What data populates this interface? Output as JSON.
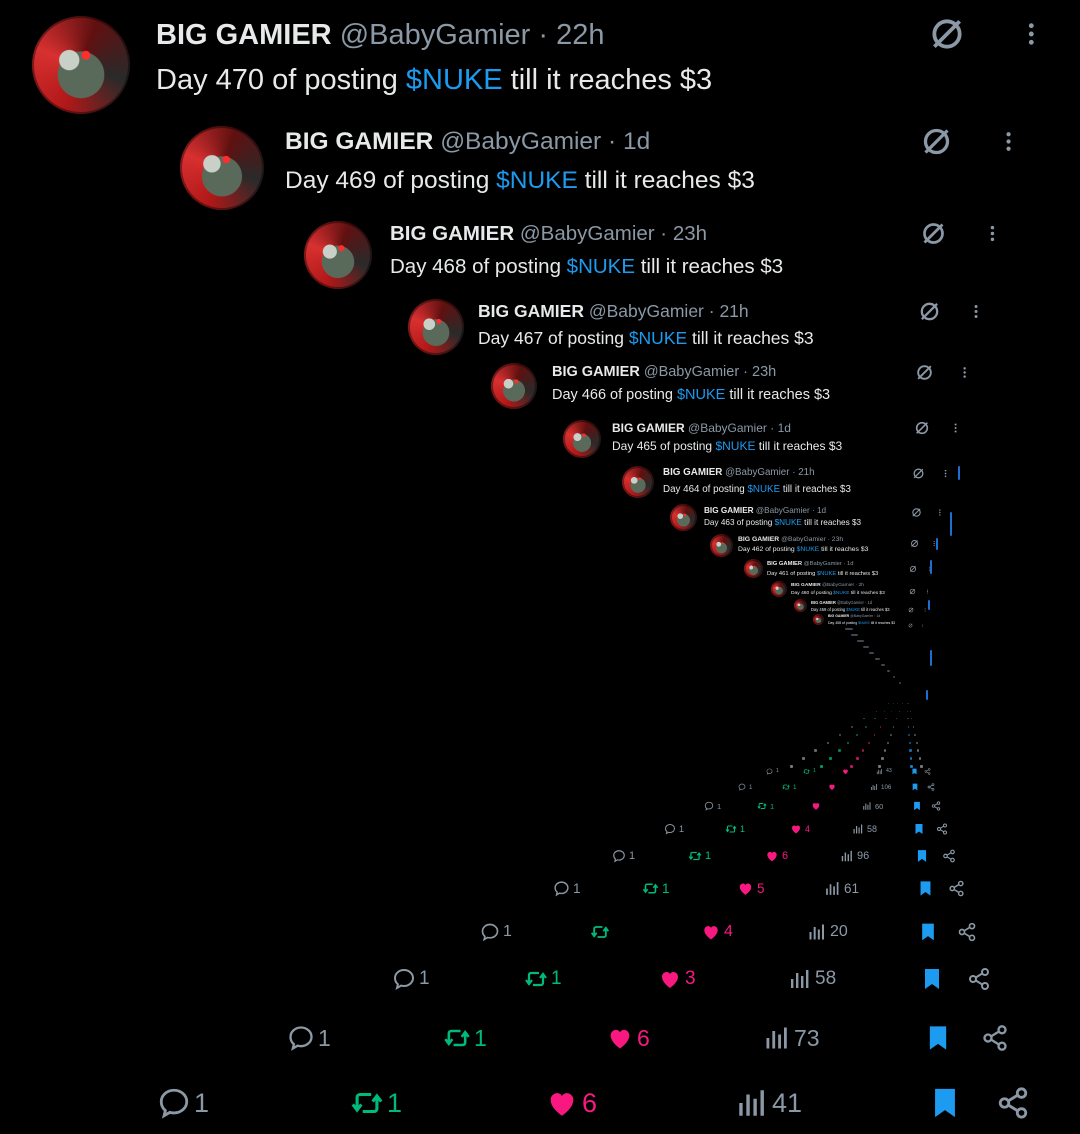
{
  "author": {
    "name": "BIG GAMIER",
    "handle": "@BabyGamier"
  },
  "body": {
    "prefix": "Day ",
    "middle": " of posting ",
    "ticker": "$NUKE",
    "suffix": " till it reaches $3"
  },
  "posts": [
    {
      "day": "470",
      "time": "22h"
    },
    {
      "day": "469",
      "time": "1d"
    },
    {
      "day": "468",
      "time": "23h"
    },
    {
      "day": "467",
      "time": "21h"
    },
    {
      "day": "466",
      "time": "23h"
    },
    {
      "day": "465",
      "time": "1d"
    },
    {
      "day": "464",
      "time": "21h"
    },
    {
      "day": "463",
      "time": "1d"
    },
    {
      "day": "462",
      "time": "23h"
    },
    {
      "day": "461",
      "time": "1d"
    },
    {
      "day": "460",
      "time": "2h"
    },
    {
      "day": "459",
      "time": "1d"
    },
    {
      "day": "458",
      "time": "1d"
    }
  ],
  "action_rows": [
    {
      "replies": "1",
      "reposts": "1",
      "likes": "6",
      "views": "41"
    },
    {
      "replies": "1",
      "reposts": "1",
      "likes": "6",
      "views": "73"
    },
    {
      "replies": "1",
      "reposts": "1",
      "likes": "3",
      "views": "58"
    },
    {
      "replies": "1",
      "reposts": "",
      "likes": "4",
      "views": "20"
    },
    {
      "replies": "1",
      "reposts": "1",
      "likes": "5",
      "views": "61"
    },
    {
      "replies": "1",
      "reposts": "1",
      "likes": "6",
      "views": "96"
    },
    {
      "replies": "1",
      "reposts": "1",
      "likes": "4",
      "views": "58"
    },
    {
      "replies": "1",
      "reposts": "1",
      "likes": "",
      "views": "60"
    },
    {
      "replies": "1",
      "reposts": "1",
      "likes": "",
      "views": "106"
    },
    {
      "replies": "1",
      "reposts": "1",
      "likes": "",
      "views": "43"
    }
  ],
  "icons": {
    "grok": "slashed-circle-icon",
    "more": "more-vertical-icon",
    "reply": "reply-icon",
    "repost": "repost-icon",
    "like": "heart-icon",
    "views": "views-icon",
    "bookmark": "bookmark-icon",
    "share": "share-icon"
  },
  "colors": {
    "link": "#1d9bf0",
    "repost": "#00ba7c",
    "like": "#f91880",
    "muted": "#8b98a5",
    "text": "#e7e9ea"
  }
}
